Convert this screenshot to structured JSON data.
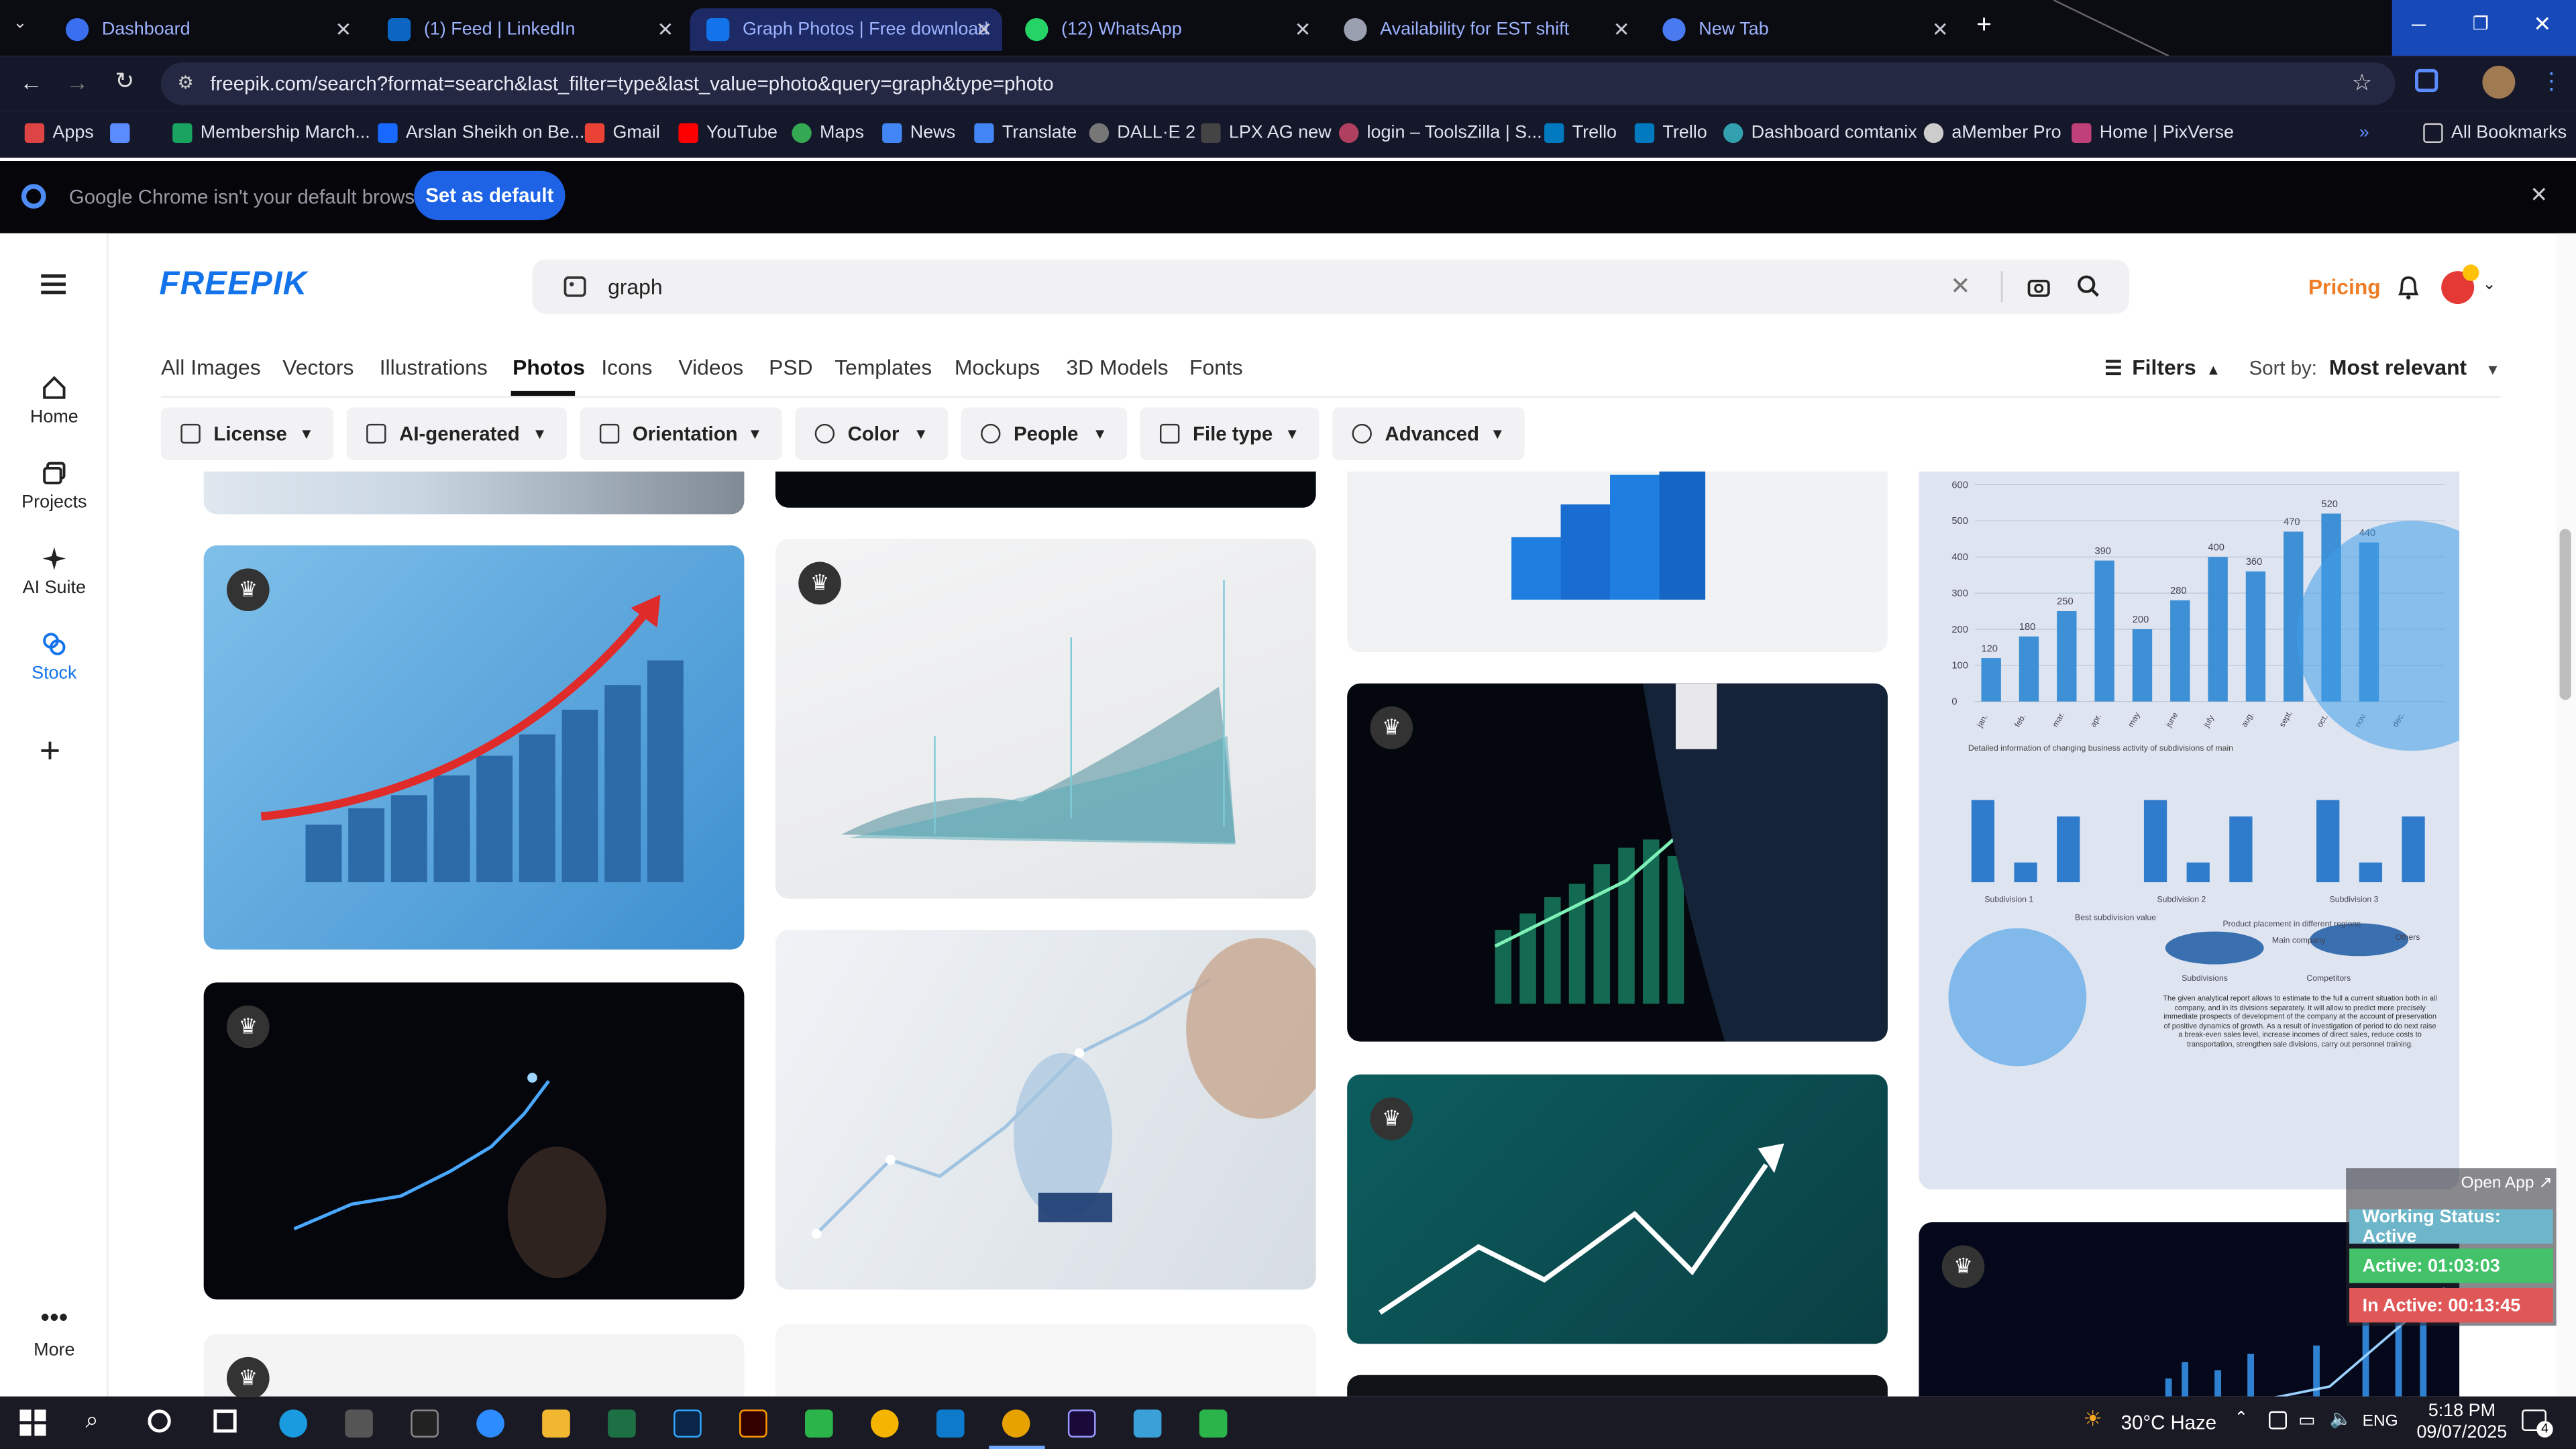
{
  "browser": {
    "tabs": [
      {
        "label": "Dashboard",
        "color": "#3a6ff0"
      },
      {
        "label": "(1) Feed | LinkedIn",
        "color": "#0a66c2"
      },
      {
        "label": "Graph Photos | Free download",
        "color": "#1273eb"
      },
      {
        "label": "(12) WhatsApp",
        "color": "#25d366"
      },
      {
        "label": "Availability for EST shift",
        "color": "#9aa0b0"
      },
      {
        "label": "New Tab",
        "color": "#4a7af0"
      }
    ],
    "url": "freepik.com/search?format=search&last_filter=type&last_value=photo&query=graph&type=photo",
    "bookmarks": [
      "Apps",
      "Membership March...",
      "Arslan Sheikh on Be...",
      "Gmail",
      "YouTube",
      "Maps",
      "News",
      "Translate",
      "DALL·E 2",
      "LPX AG new",
      "login – ToolsZilla | S...",
      "Trello",
      "Trello",
      "Dashboard comtanix",
      "aMember Pro",
      "Home | PixVerse",
      "All Bookmarks"
    ],
    "infobar": {
      "message": "Google Chrome isn't your default browser",
      "button": "Set as default"
    }
  },
  "site": {
    "logo": "FREEPIK",
    "search_value": "graph",
    "pricing": "Pricing",
    "rail": [
      "Home",
      "Projects",
      "AI Suite",
      "Stock",
      "More"
    ],
    "categories": [
      "All Images",
      "Vectors",
      "Illustrations",
      "Photos",
      "Icons",
      "Videos",
      "PSD",
      "Templates",
      "Mockups",
      "3D Models",
      "Fonts"
    ],
    "selected_category": "Photos",
    "filters_label": "Filters",
    "sort_label": "Sort by:",
    "sort_value": "Most relevant",
    "chips": [
      "License",
      "AI-generated",
      "Orientation",
      "Color",
      "People",
      "File type",
      "Advanced"
    ]
  },
  "gallery": {
    "report_chart": {
      "y_ticks": [
        "600",
        "500",
        "400",
        "300",
        "200",
        "100",
        "0"
      ],
      "bar_labels": [
        "120",
        "180",
        "250",
        "390",
        "200",
        "280",
        "400",
        "360",
        "470",
        "520",
        "440"
      ],
      "x_labels": [
        "jan.",
        "feb.",
        "mar.",
        "apr.",
        "may",
        "june",
        "july",
        "aug.",
        "sept.",
        "oct.",
        "nov.",
        "dec."
      ],
      "section_title": "Detailed information of changing business activity of subdivisions of main",
      "subdivisions": [
        "Subdivision 1",
        "Subdivision 2",
        "Subdivision 3"
      ],
      "pie_labels": [
        "Best subdivision value",
        "Product placement in different regions",
        "Main company",
        "Others",
        "Subdivisions",
        "Competitors"
      ],
      "paragraph": "The given analytical report allows to estimate to the full a current situation both in all company, and in its divisions separately. It will allow to predict more precisely immediate prospects of development of the company at the account of preservation of positive dynamics of growth. As a result of investigation of period to do next raise a break-even sales level, increase incomes of direct sales, reduce costs to transportation, strengthen sale divisions, carry out personnel training.",
      "months_small": [
        "Jan",
        "Feb",
        "Mar",
        "Apr",
        "May",
        "Jun",
        "Jul",
        "Aug",
        "Sep",
        "Oct",
        "Nov",
        "Dec"
      ]
    }
  },
  "widget": {
    "open_app": "Open App ↗",
    "status": "Working Status: Active",
    "active": "Active: 01:03:03",
    "inactive": "In Active: 00:13:45"
  },
  "taskbar": {
    "weather": "30°C  Haze",
    "lang": "ENG",
    "time": "5:18 PM",
    "date": "09/07/2025",
    "notif": "4"
  }
}
